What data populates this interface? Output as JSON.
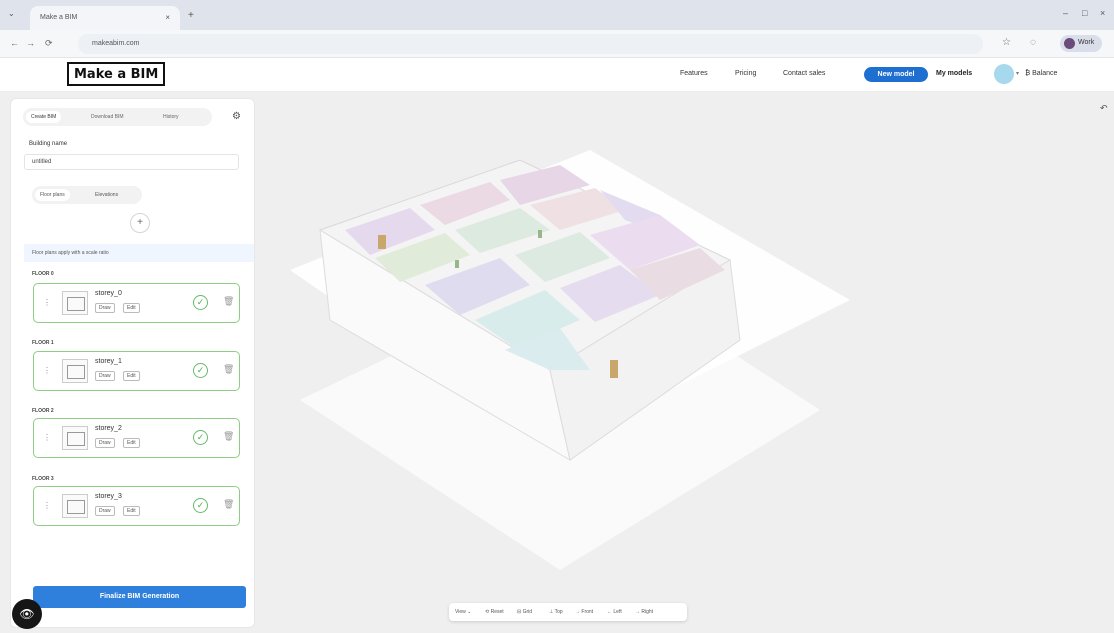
{
  "browser": {
    "tab_title": "Make a BIM",
    "url": "makeabim.com",
    "profile_label": "Work"
  },
  "nav": {
    "logo": "Make a BIM",
    "links": [
      "Features",
      "Pricing",
      "Contact sales"
    ],
    "new_model": "New model",
    "my_models": "My models",
    "balance": "₿ Balance"
  },
  "panel": {
    "tabs": [
      "Create BIM",
      "Download BIM",
      "History"
    ],
    "building_name_label": "Building name",
    "building_name_value": "untitled",
    "sub_tabs": [
      "Floor plans",
      "Elevations"
    ],
    "info_text": "Floor plans apply with a scale ratio",
    "floors": [
      {
        "label": "FLOOR 0",
        "name": "storey_0",
        "btn1": "Draw",
        "btn2": "Edit"
      },
      {
        "label": "FLOOR 1",
        "name": "storey_1",
        "btn1": "Draw",
        "btn2": "Edit"
      },
      {
        "label": "FLOOR 2",
        "name": "storey_2",
        "btn1": "Draw",
        "btn2": "Edit"
      },
      {
        "label": "FLOOR 3",
        "name": "storey_3",
        "btn1": "Draw",
        "btn2": "Edit"
      }
    ],
    "finalize": "Finalize BIM Generation"
  },
  "toolbar": {
    "items": [
      "View ⌄",
      "⟲ Reset",
      "⊟ Grid",
      "⊥ Top",
      "→ Front",
      "← Left",
      "→ Right"
    ]
  },
  "colors": {
    "accent": "#1f6fd1",
    "success": "#8ecd84"
  }
}
